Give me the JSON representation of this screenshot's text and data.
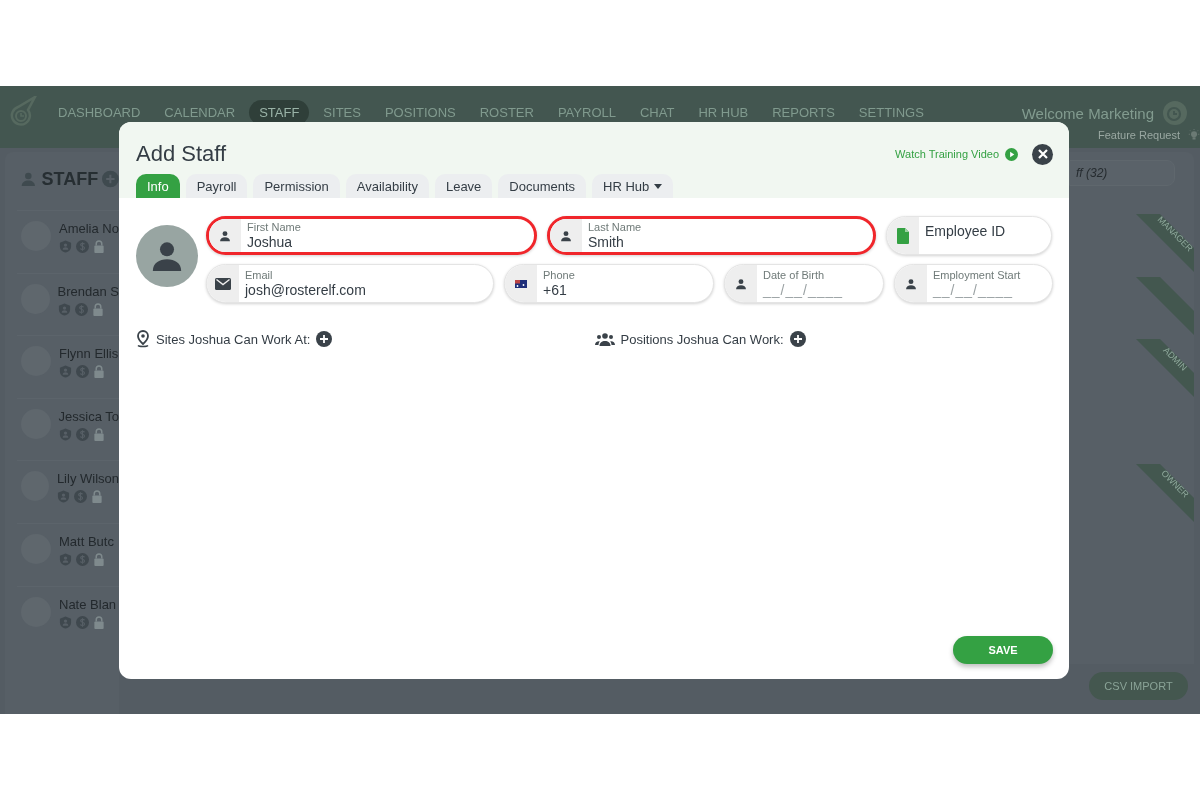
{
  "app": {
    "nav": [
      {
        "label": "DASHBOARD",
        "selected": false
      },
      {
        "label": "CALENDAR",
        "selected": false
      },
      {
        "label": "STAFF",
        "selected": true
      },
      {
        "label": "SITES",
        "selected": false
      },
      {
        "label": "POSITIONS",
        "selected": false
      },
      {
        "label": "ROSTER",
        "selected": false
      },
      {
        "label": "PAYROLL",
        "selected": false
      },
      {
        "label": "CHAT",
        "selected": false
      },
      {
        "label": "HR HUB",
        "selected": false
      },
      {
        "label": "REPORTS",
        "selected": false
      },
      {
        "label": "SETTINGS",
        "selected": false
      }
    ],
    "welcome": "Welcome Marketing",
    "feature_request": "Feature Request"
  },
  "staff_panel": {
    "title": "STAFF",
    "search_value": "ff (32)",
    "rows": [
      {
        "name": "Amelia No",
        "ribbon": true,
        "ribbon_label": "MANAGER"
      },
      {
        "name": "Brendan S",
        "ribbon": true
      },
      {
        "name": "Flynn Ellis",
        "ribbon": true,
        "ribbon_label": "ADMIN"
      },
      {
        "name": "Jessica To",
        "ribbon": false
      },
      {
        "name": "Lily Wilson",
        "ribbon": true,
        "ribbon_label": "OWNER"
      },
      {
        "name": "Matt Butc",
        "ribbon": false
      },
      {
        "name": "Nate Blan",
        "ribbon": false
      }
    ],
    "csv_button": "CSV IMPORT"
  },
  "modal": {
    "title": "Add Staff",
    "training_link": "Watch Training Video",
    "tabs": [
      {
        "label": "Info",
        "selected": true,
        "dropdown": false
      },
      {
        "label": "Payroll",
        "selected": false,
        "dropdown": false
      },
      {
        "label": "Permission",
        "selected": false,
        "dropdown": false
      },
      {
        "label": "Availability",
        "selected": false,
        "dropdown": false
      },
      {
        "label": "Leave",
        "selected": false,
        "dropdown": false
      },
      {
        "label": "Documents",
        "selected": false,
        "dropdown": false
      },
      {
        "label": "HR Hub",
        "selected": false,
        "dropdown": true
      }
    ],
    "field_rows": [
      [
        {
          "kind": "person",
          "label": "First Name",
          "value": "Joshua",
          "highlighted": true
        },
        {
          "kind": "person",
          "label": "Last Name",
          "value": "Smith",
          "highlighted": true
        },
        {
          "kind": "id",
          "placeholder": "Employee ID",
          "highlighted": false
        }
      ],
      [
        {
          "kind": "email",
          "label": "Email",
          "value": "josh@rosterelf.com",
          "highlighted": false
        },
        {
          "kind": "phone",
          "label": "Phone",
          "value": "+61",
          "highlighted": false
        },
        {
          "kind": "person",
          "label": "Date of Birth",
          "placeholder": "__/__/____",
          "highlighted": false
        },
        {
          "kind": "person",
          "label": "Employment Start",
          "placeholder": "__/__/____",
          "highlighted": false
        }
      ]
    ],
    "sections": [
      {
        "kind": "sites",
        "label": "Sites Joshua Can Work At:"
      },
      {
        "kind": "positions",
        "label": "Positions Joshua Can Work:"
      }
    ],
    "save_button": "SAVE"
  }
}
